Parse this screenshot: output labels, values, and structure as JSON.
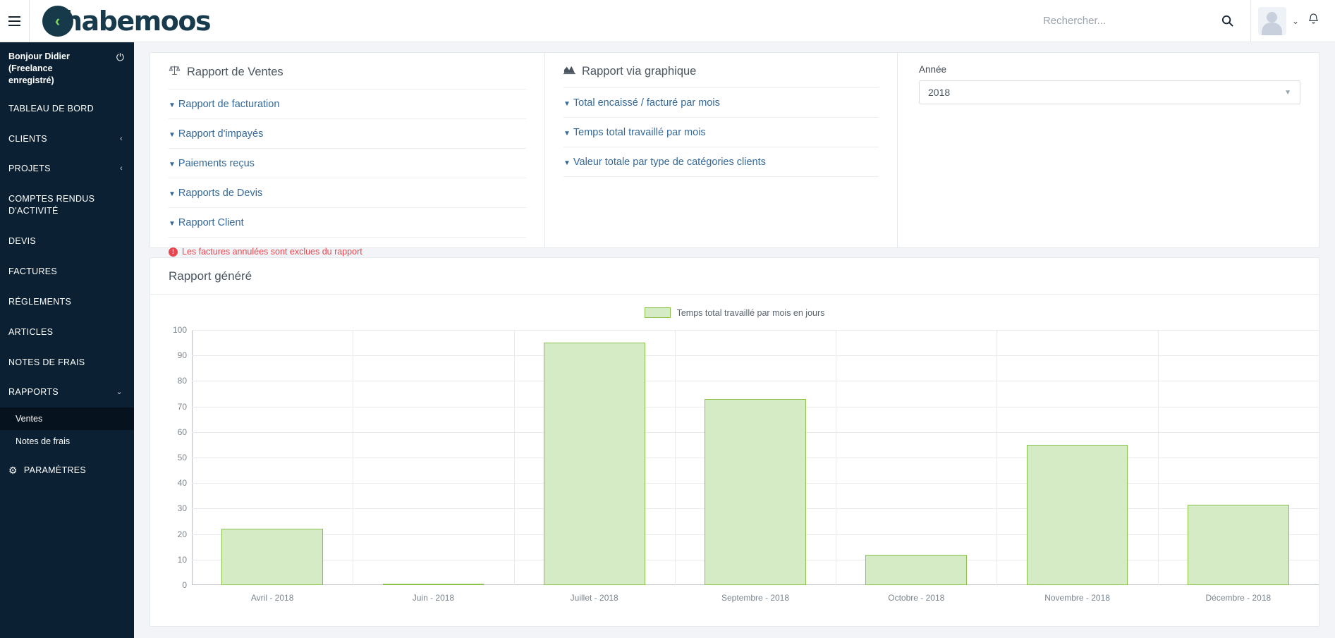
{
  "topbar": {
    "hamburger_icon": "hamburger-menu-icon",
    "logo_text": "habemoos",
    "logo_chevron": "‹",
    "search_placeholder": "Rechercher...",
    "search_value": "",
    "search_icon": "search-icon",
    "avatar_icon": "user-avatar-icon",
    "caret_icon": "⌄",
    "bell_icon": "notification-bell-icon"
  },
  "sidebar": {
    "greeting": "Bonjour Didier (Freelance enregistré)",
    "power_icon": "⏻",
    "items": [
      {
        "label": "TABLEAU DE BORD",
        "arrow": ""
      },
      {
        "label": "CLIENTS",
        "arrow": "‹"
      },
      {
        "label": "PROJETS",
        "arrow": "‹"
      },
      {
        "label": "COMPTES RENDUS D'ACTIVITÉ",
        "arrow": ""
      },
      {
        "label": "DEVIS",
        "arrow": ""
      },
      {
        "label": "FACTURES",
        "arrow": ""
      },
      {
        "label": "RÉGLEMENTS",
        "arrow": ""
      },
      {
        "label": "ARTICLES",
        "arrow": ""
      },
      {
        "label": "NOTES DE FRAIS",
        "arrow": ""
      },
      {
        "label": "RAPPORTS",
        "arrow": "⌄"
      }
    ],
    "subitems": [
      {
        "label": "Ventes",
        "active": true
      },
      {
        "label": "Notes de frais",
        "active": false
      }
    ],
    "settings": {
      "label": "PARAMÈTRES",
      "icon": "gear-icon"
    }
  },
  "sales_panel": {
    "title": "Rapport de Ventes",
    "title_icon": "scales-balance-icon",
    "links": [
      "Rapport de facturation",
      "Rapport d'impayés",
      "Paiements reçus",
      "Rapports de Devis",
      "Rapport Client"
    ],
    "warning": "Les factures annulées sont exclues du rapport",
    "warning_icon": "exclamation-circle-icon"
  },
  "graph_panel": {
    "title": "Rapport via graphique",
    "title_icon": "area-chart-icon",
    "links": [
      "Total encaissé / facturé par mois",
      "Temps total travaillé par mois",
      "Valeur totale par type de catégories clients"
    ]
  },
  "year_panel": {
    "label": "Année",
    "selected": "2018",
    "caret_icon": "chevron-down-icon"
  },
  "report": {
    "title": "Rapport généré"
  },
  "chart_data": {
    "type": "bar",
    "title": "Rapport généré",
    "xlabel": "",
    "ylabel": "",
    "ylim": [
      0,
      100
    ],
    "yticks": [
      0,
      10,
      20,
      30,
      40,
      50,
      60,
      70,
      80,
      90,
      100
    ],
    "grid": true,
    "legend_position": "top-center",
    "legend": [
      "Temps total travaillé par mois en jours"
    ],
    "series": [
      {
        "name": "Temps total travaillé par mois en jours",
        "color": "#d4ebc6",
        "border_color": "#8bc34a",
        "values": [
          22,
          0.5,
          95,
          73,
          12,
          55,
          31.5
        ]
      }
    ],
    "categories": [
      "Avril - 2018",
      "Juin - 2018",
      "Juillet - 2018",
      "Septembre - 2018",
      "Octobre - 2018",
      "Novembre - 2018",
      "Décembre - 2018"
    ]
  },
  "colors": {
    "sidebar_bg": "#0b2133",
    "sidebar_active": "#06121d",
    "link_blue": "#34699a",
    "danger_red": "#e8464f",
    "bar_fill": "#d4ebc6",
    "bar_stroke": "#8bc34a",
    "page_bg": "#f2f4f7"
  }
}
